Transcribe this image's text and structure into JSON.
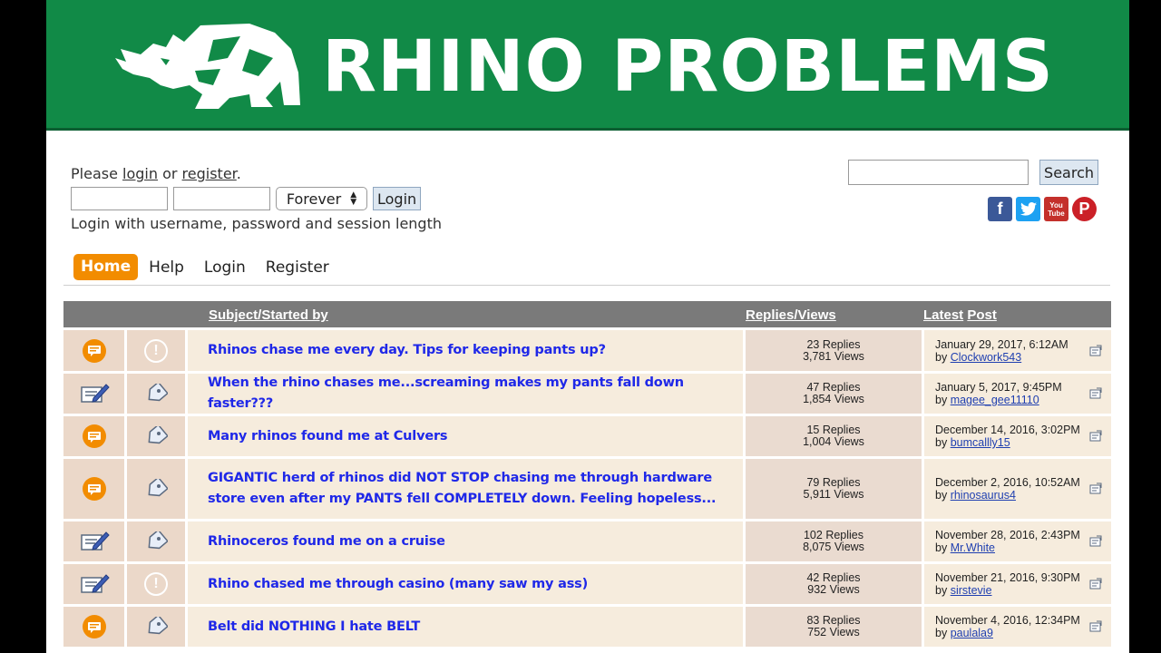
{
  "banner": {
    "title": "RHINO PROBLEMS",
    "color": "#118a47"
  },
  "login": {
    "prompt_before": "Please ",
    "login_link": "login",
    "prompt_mid": " or ",
    "register_link": "register",
    "prompt_end": ".",
    "session_value": "Forever",
    "login_button": "Login",
    "hint": "Login with username, password and session length"
  },
  "search": {
    "button": "Search"
  },
  "social": {
    "facebook": "f",
    "youtube_line1": "You",
    "youtube_line2": "Tube",
    "pinterest": "P"
  },
  "nav": {
    "home": "Home",
    "help": "Help",
    "login": "Login",
    "register": "Register"
  },
  "table": {
    "col_subject": "Subject/Started by",
    "col_replies": "Replies/Views",
    "col_latest_a": "Latest",
    "col_latest_b": "Post",
    "rows": [
      {
        "status": "hot",
        "topic_icon": "exclamation",
        "subject": "Rhinos chase me every day. Tips for keeping pants up?",
        "replies": "23 Replies",
        "views": "3,781 Views",
        "date": "January 29, 2017, 6:12AM",
        "by": "by ",
        "user": "Clockwork543"
      },
      {
        "status": "sticky",
        "topic_icon": "tag",
        "subject": "When the rhino chases me...screaming makes my pants fall down faster???",
        "replies": "47 Replies",
        "views": "1,854 Views",
        "date": "January 5, 2017, 9:45PM",
        "by": "by ",
        "user": "magee_gee11110"
      },
      {
        "status": "hot",
        "topic_icon": "tag",
        "subject": "Many rhinos found me at Culvers",
        "replies": "15 Replies",
        "views": "1,004 Views",
        "date": "December 14, 2016, 3:02PM",
        "by": "by ",
        "user": "bumcallly15"
      },
      {
        "status": "hot",
        "topic_icon": "tag",
        "subject": "GIGANTIC herd of rhinos did NOT STOP chasing me through hardware store even after my PANTS fell COMPLETELY down. Feeling hopeless...",
        "replies": "79 Replies",
        "views": "5,911 Views",
        "date": "December 2, 2016, 10:52AM",
        "by": "by ",
        "user": "rhinosaurus4"
      },
      {
        "status": "sticky",
        "topic_icon": "tag",
        "subject": "Rhinoceros found me on a cruise",
        "replies": "102 Replies",
        "views": "8,075 Views",
        "date": "November 28, 2016, 2:43PM",
        "by": "by ",
        "user": "Mr.White"
      },
      {
        "status": "sticky",
        "topic_icon": "exclamation",
        "subject": "Rhino chased me through casino (many saw my ass)",
        "replies": "42 Replies",
        "views": "932 Views",
        "date": "November 21, 2016, 9:30PM",
        "by": "by ",
        "user": "sirstevie"
      },
      {
        "status": "hot",
        "topic_icon": "tag",
        "subject": "Belt did NOTHING I hate BELT",
        "replies": "83 Replies",
        "views": "752 Views",
        "date": "November 4, 2016, 12:34PM",
        "by": "by ",
        "user": "paulala9"
      }
    ]
  }
}
